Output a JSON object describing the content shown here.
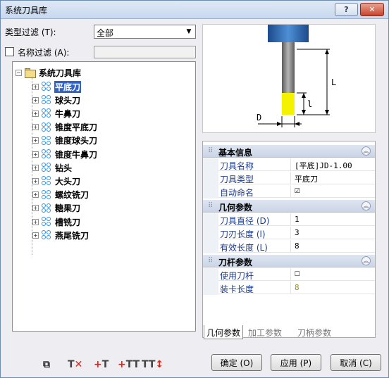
{
  "window": {
    "title": "系统刀具库",
    "help_label": "?",
    "close_label": "✕"
  },
  "filter": {
    "type_label": "类型过滤 (T):",
    "type_value": "全部",
    "name_label": "名称过滤 (A):",
    "name_checked": false,
    "name_value": ""
  },
  "tree": {
    "root": "系统刀具库",
    "items": [
      "平底刀",
      "球头刀",
      "牛鼻刀",
      "锥度平底刀",
      "锥度球头刀",
      "锥度牛鼻刀",
      "钻头",
      "大头刀",
      "螺纹铣刀",
      "糖果刀",
      "槽铣刀",
      "燕尾铣刀"
    ],
    "selected_index": 0
  },
  "toolbar_icons": [
    "copy-icon",
    "delete-icon",
    "add-tool-icon",
    "add-tool-group-icon",
    "sort-icon"
  ],
  "preview": {
    "label_L": "L",
    "label_l": "l",
    "label_D": "D"
  },
  "properties": {
    "groups": [
      {
        "title": "基本信息",
        "rows": [
          {
            "key": "刀具名称",
            "value": "[平底]JD-1.00"
          },
          {
            "key": "刀具类型",
            "value": "平底刀"
          },
          {
            "key": "自动命名",
            "value": "☑",
            "checkbox": true
          }
        ]
      },
      {
        "title": "几何参数",
        "rows": [
          {
            "key": "刀具直径 (D)",
            "value": "1"
          },
          {
            "key": "刀刃长度 (l)",
            "value": "3"
          },
          {
            "key": "有效长度 (L)",
            "value": "8"
          }
        ]
      },
      {
        "title": "刀杆参数",
        "rows": [
          {
            "key": "使用刀杆",
            "value": "☐",
            "checkbox": true
          },
          {
            "key": "装卡长度",
            "value": "8",
            "muted": true
          }
        ]
      }
    ]
  },
  "tabs": [
    "几何参数",
    "加工参数",
    "刀柄参数"
  ],
  "buttons": {
    "ok": "确定 (O)",
    "apply": "应用 (P)",
    "cancel": "取消 (C)"
  },
  "colors": {
    "accent": "#3163c5",
    "tool_icon": "#2f8fe6",
    "tool_tip": "#f5f200"
  }
}
